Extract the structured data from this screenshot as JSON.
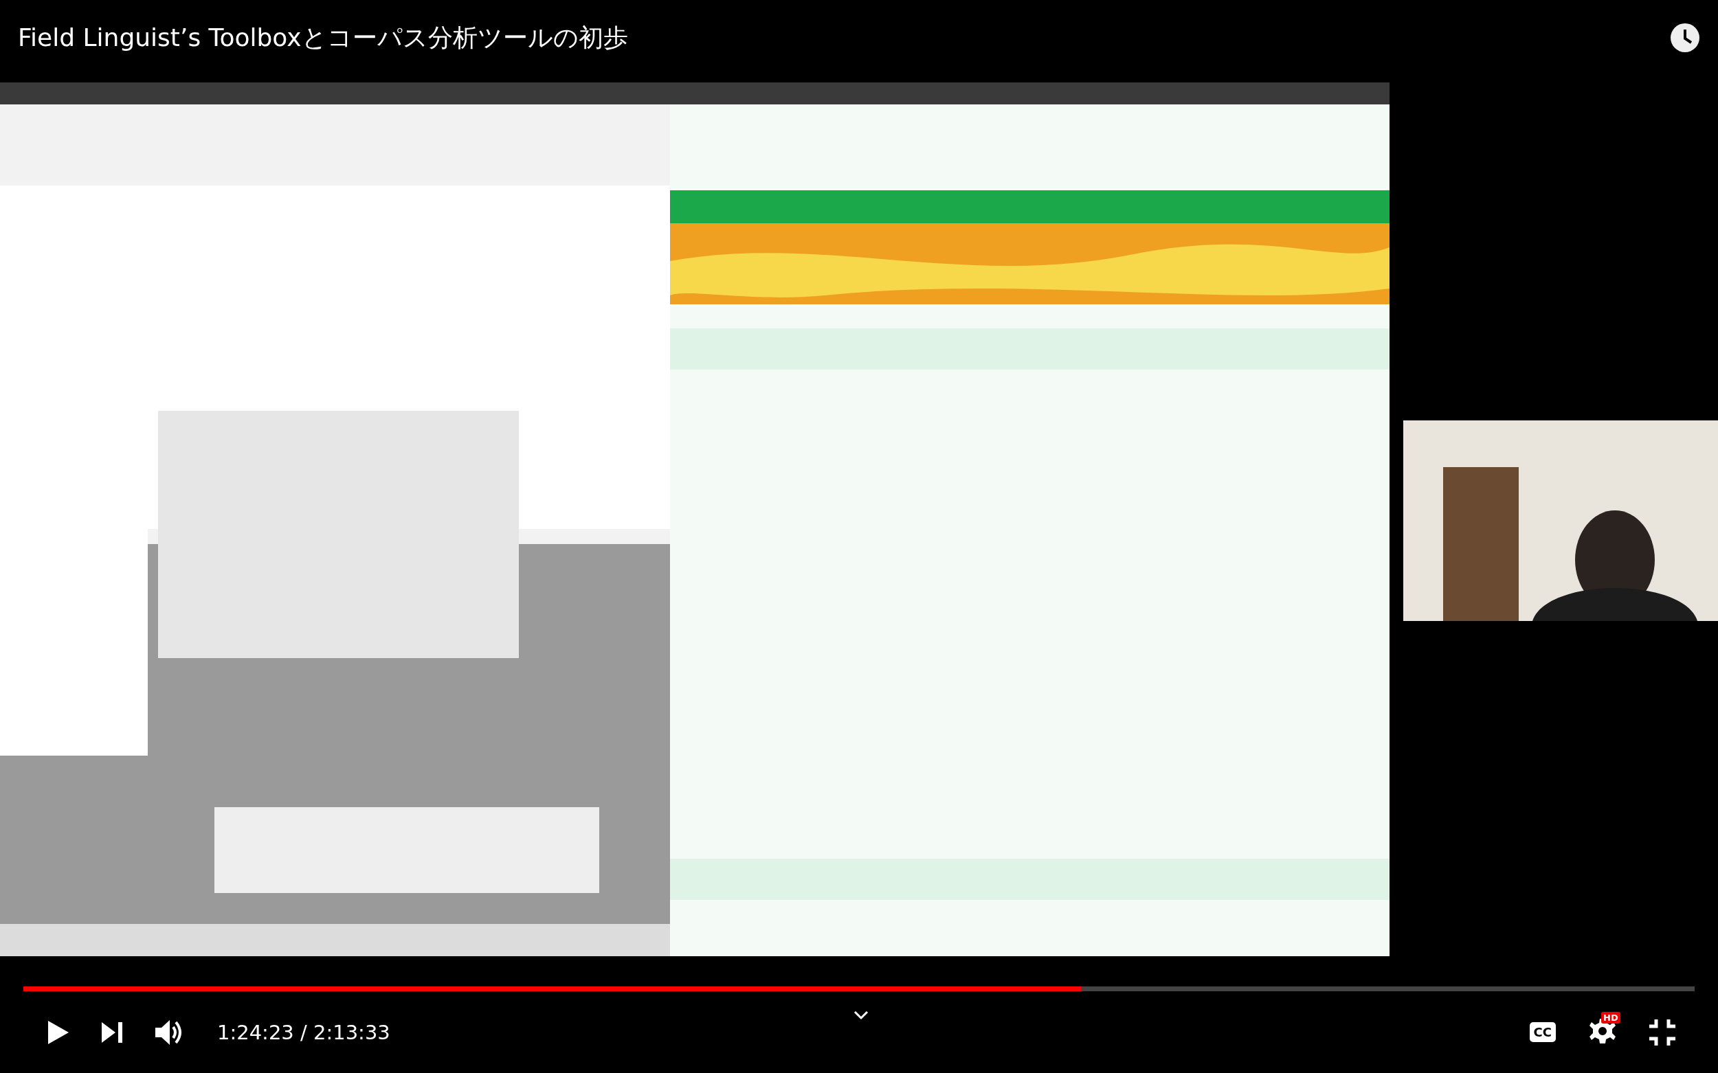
{
  "video": {
    "title": "Field Linguist’s Toolboxとコーパス分析ツールの初歩"
  },
  "player": {
    "progress": {
      "level": 0.633
    },
    "time": "1:24:23 / 2:13:33",
    "captions_label": "CC",
    "quality_badge": "HD"
  }
}
